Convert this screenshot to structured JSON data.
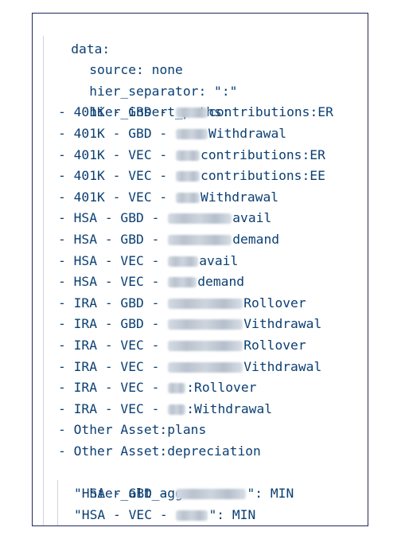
{
  "editor": {
    "root_key": "data:",
    "source_line": "source: none",
    "hier_separator_line": "hier_separator: \":\"",
    "hier_insert_paths_key": "hier_insert_paths:",
    "insert_paths": [
      {
        "prefix": "- 401K - GBD - ",
        "suffix": "contributions:ER"
      },
      {
        "prefix": "- 401K - GBD - ",
        "suffix": "Withdrawal"
      },
      {
        "prefix": "- 401K - VEC - ",
        "suffix": "contributions:ER"
      },
      {
        "prefix": "- 401K - VEC - ",
        "suffix": "contributions:EE"
      },
      {
        "prefix": "- 401K - VEC - ",
        "suffix": "Withdrawal"
      },
      {
        "prefix": "- HSA - GBD - ",
        "suffix": "avail"
      },
      {
        "prefix": "- HSA - GBD - ",
        "suffix": "demand"
      },
      {
        "prefix": "- HSA - VEC - ",
        "suffix": "avail"
      },
      {
        "prefix": "- HSA - VEC - ",
        "suffix": "demand"
      },
      {
        "prefix": "- IRA - GBD - ",
        "suffix": "Rollover"
      },
      {
        "prefix": "- IRA - GBD - ",
        "suffix": "Vithdrawal"
      },
      {
        "prefix": "- IRA - VEC - ",
        "suffix": "Rollover"
      },
      {
        "prefix": "- IRA - VEC - ",
        "suffix": "Vithdrawal"
      },
      {
        "prefix": "- IRA - VEC - ",
        "suffix": ":Rollover"
      },
      {
        "prefix": "- IRA - VEC - ",
        "suffix": ":Withdrawal"
      }
    ],
    "other_paths": [
      "- Other Asset:plans",
      "- Other Asset:depreciation"
    ],
    "hier_alt_agg_key": "hier_alt_agg:",
    "alt_agg": [
      {
        "prefix": "\"HSA - GBD - ",
        "suffix": "\": MIN"
      },
      {
        "prefix": "\"HSA - VEC - ",
        "suffix": "\": MIN"
      }
    ]
  }
}
